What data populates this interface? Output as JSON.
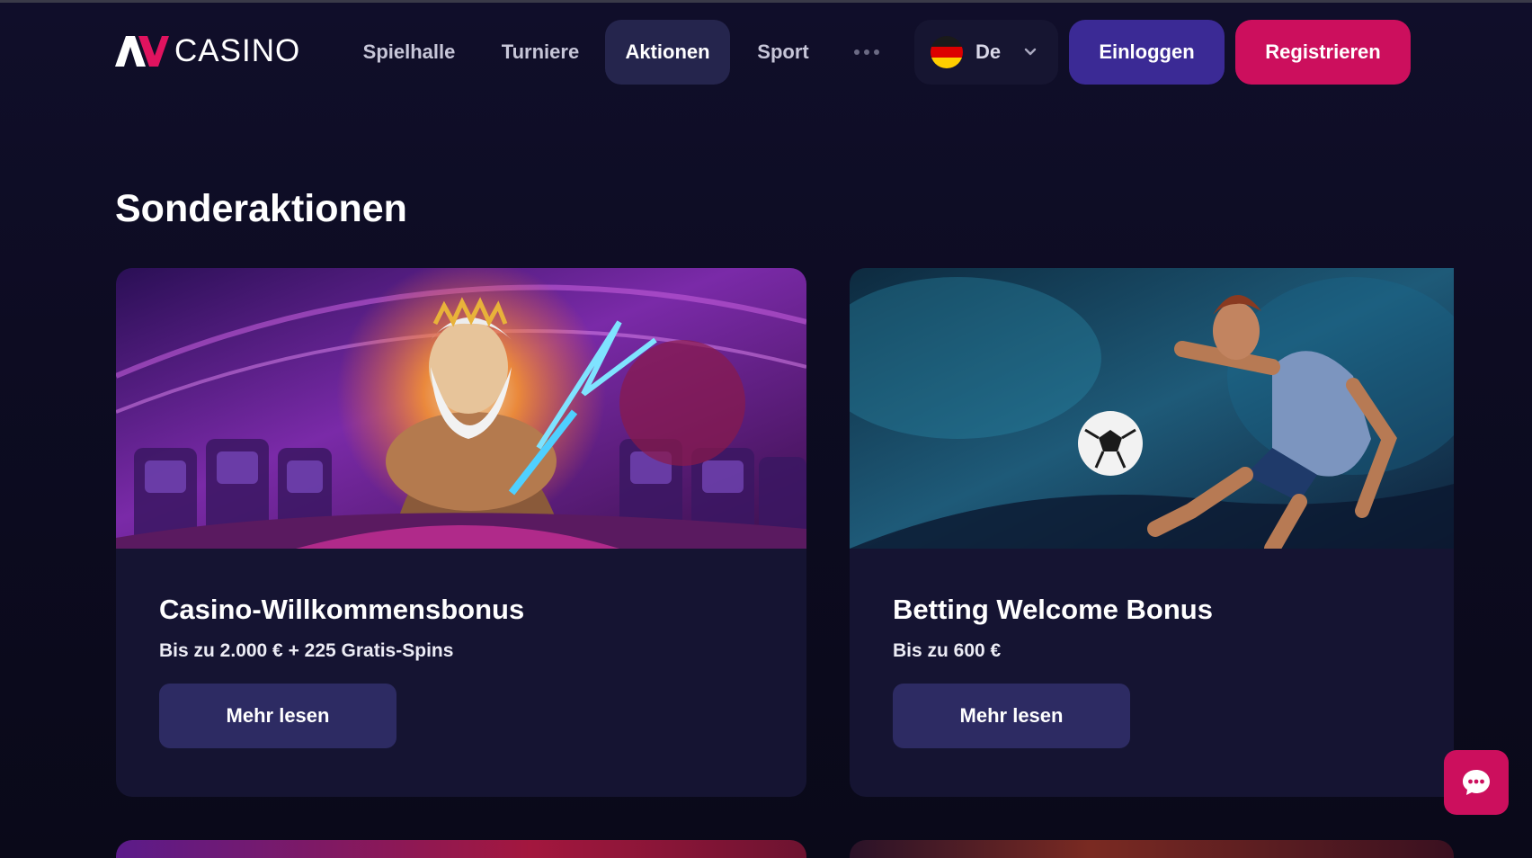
{
  "brand": {
    "name": "CASINO",
    "logo_icon": "av-logo-icon"
  },
  "nav": {
    "items": [
      {
        "label": "Spielhalle",
        "active": false
      },
      {
        "label": "Turniere",
        "active": false
      },
      {
        "label": "Aktionen",
        "active": true
      },
      {
        "label": "Sport",
        "active": false
      }
    ],
    "more_icon": "more-dots-icon"
  },
  "language": {
    "code": "De",
    "flag": "germany-flag-icon"
  },
  "auth": {
    "login_label": "Einloggen",
    "register_label": "Registrieren"
  },
  "main": {
    "section_title": "Sonderaktionen",
    "promotions": [
      {
        "title": "Casino-Willkommensbonus",
        "subtitle": "Bis zu 2.000 € + 225 Gratis-Spins",
        "button_label": "Mehr lesen",
        "image": "zeus-casino-illustration"
      },
      {
        "title": "Betting Welcome Bonus",
        "subtitle": "Bis zu 600 €",
        "button_label": "Mehr lesen",
        "image": "soccer-player-illustration"
      }
    ]
  },
  "chat": {
    "icon": "chat-bubble-icon"
  },
  "colors": {
    "background": "#0c0b1d",
    "card": "#151432",
    "primary_button": "#3b2a95",
    "accent": "#cc0f5d",
    "nav_active": "#25254d",
    "card_button": "#2d2b63"
  }
}
